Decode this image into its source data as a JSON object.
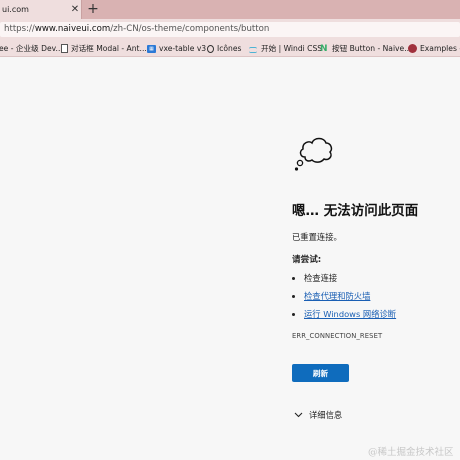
{
  "browser": {
    "tab": {
      "title": "ui.com",
      "close": "✕"
    },
    "new_tab": "+",
    "address": {
      "prefix": "https://",
      "host": "www.naiveui.com",
      "path": "/zh-CN/os-theme/components/button"
    },
    "bookmarks": [
      {
        "label": "ee - 企业级 Dev...",
        "icon": "none"
      },
      {
        "label": "对话框 Modal - Ant...",
        "icon": "doc-icon"
      },
      {
        "label": "vxe-table v3",
        "icon": "vxe-icon"
      },
      {
        "label": "Icônes",
        "icon": "drop-icon"
      },
      {
        "label": "开始 | Windi CSS",
        "icon": "windi-icon"
      },
      {
        "label": "按钮 Button - Naive...",
        "icon": "naive-icon"
      },
      {
        "label": "Examples - A",
        "icon": "examples-icon"
      }
    ]
  },
  "error_page": {
    "heading": "嗯… 无法访问此页面",
    "subtext": "已重置连接。",
    "try_title": "请尝试:",
    "suggestions": [
      {
        "text": "检查连接",
        "link": false
      },
      {
        "text": "检查代理和防火墙",
        "link": true
      },
      {
        "text": "运行 Windows 网络诊断",
        "link": true
      }
    ],
    "error_code": "ERR_CONNECTION_RESET",
    "refresh_label": "刷新",
    "details_label": "详细信息"
  },
  "watermark": "@稀土掘金技术社区",
  "colors": {
    "accent": "#0f6cbd",
    "link": "#1a5fb4",
    "titlebar": "#d9b2b2",
    "toolbar": "#efdede"
  }
}
